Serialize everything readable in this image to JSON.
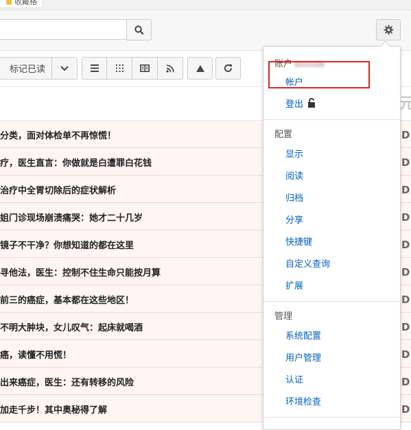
{
  "browser": {
    "tab_title": "收藏格"
  },
  "search": {
    "placeholder": "",
    "value": ""
  },
  "toolbar": {
    "mark_read_label": "标记已读"
  },
  "list": {
    "header_char": "元",
    "rows": [
      "分类，面对体检单不再惊慌！",
      "疗，医生直言：你做就是白遭罪白花钱",
      "治疗中全胃切除后的症状解析",
      "姐门诊现场崩溃痛哭：她才二十几岁",
      "镜子不干净？你想知道的都在这里",
      "寻他法，医生：控制不住生命只能按月算",
      "前三的癌症，基本都在这些地区！",
      "不明大肿块，女儿叹气：起床就喝酒",
      "癌，读懂不用慌！",
      "出来癌症，医生：还有转移的风险",
      "加走千步！其中奥秘得了解"
    ]
  },
  "menu": {
    "account_section": "账户",
    "account": "帐户",
    "logout": "登出",
    "config_section": "配置",
    "config_items": [
      "显示",
      "阅读",
      "归档",
      "分享",
      "快捷键",
      "自定义查询",
      "扩展"
    ],
    "admin_section": "管理",
    "admin_items": [
      "系统配置",
      "用户管理",
      "认证",
      "环境检查"
    ]
  }
}
